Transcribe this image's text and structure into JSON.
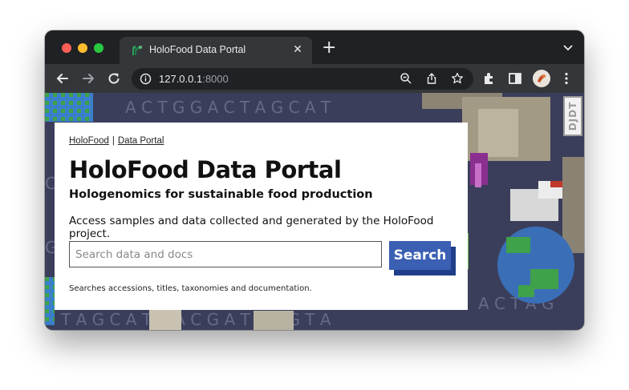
{
  "browser": {
    "tab": {
      "title": "HoloFood Data Portal",
      "favicon": "holofood-sprout-icon",
      "close_icon": "close-icon"
    },
    "new_tab_icon": "plus-icon",
    "address_bar": {
      "host": "127.0.0.1",
      "port": ":8000"
    },
    "toolbar_icons": [
      "back-icon",
      "forward-icon",
      "reload-icon",
      "info-icon",
      "zoom-icon",
      "share-icon",
      "bookmark-star-icon",
      "extensions-icon",
      "side-panel-icon",
      "profile-avatar",
      "menu-icon"
    ]
  },
  "page": {
    "breadcrumb": {
      "home": "HoloFood",
      "separator": "|",
      "current": "Data Portal"
    },
    "title": "HoloFood Data Portal",
    "subtitle": "Hologenomics for sustainable food production",
    "description": "Access samples and data collected and generated by the HoloFood project.",
    "search": {
      "placeholder": "Search data and docs",
      "button_label": "Search",
      "hint": "Searches accessions, titles, taxonomies and documentation."
    },
    "debug_toolbar": {
      "label": "DJDT"
    }
  },
  "colors": {
    "button": "#3a5fb3",
    "button_shadow": "#1f3f8a",
    "chrome_dark": "#202124",
    "chrome_mid": "#35363a"
  }
}
